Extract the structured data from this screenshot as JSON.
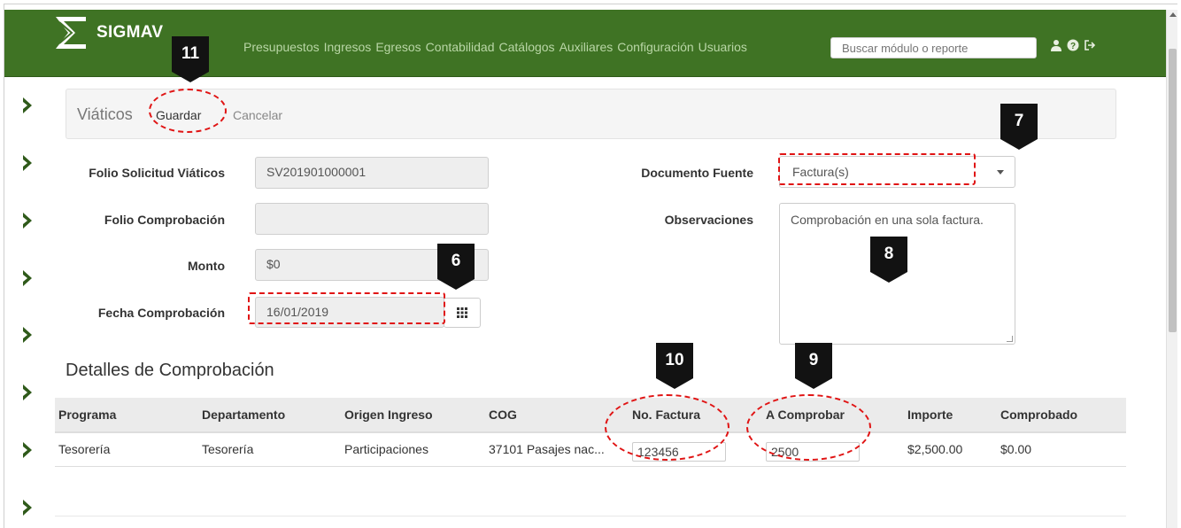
{
  "navbar": {
    "brand": "SIGMAV",
    "menu": [
      "Presupuestos",
      "Ingresos",
      "Egresos",
      "Contabilidad",
      "Catálogos",
      "Auxiliares",
      "Configuración",
      "Usuarios"
    ],
    "search_placeholder": "Buscar módulo o reporte",
    "icons": [
      "user-icon",
      "help-icon",
      "logout-icon"
    ],
    "color": "#3f7324"
  },
  "panel": {
    "title": "Viáticos",
    "save_label": "Guardar",
    "cancel_label": "Cancelar"
  },
  "form": {
    "folio_solicitud": {
      "label": "Folio Solicitud Viáticos",
      "value": "SV201901000001"
    },
    "folio_comprobacion": {
      "label": "Folio Comprobación",
      "value": ""
    },
    "monto": {
      "label": "Monto",
      "value": "$0"
    },
    "fecha": {
      "label": "Fecha Comprobación",
      "value": "16/01/2019"
    },
    "documento_fuente": {
      "label": "Documento Fuente",
      "value": "Factura(s)"
    },
    "observaciones": {
      "label": "Observaciones",
      "value": "Comprobación en una sola factura."
    }
  },
  "details": {
    "title": "Detalles de Comprobación",
    "columns": [
      "Programa",
      "Departamento",
      "Origen Ingreso",
      "COG",
      "No. Factura",
      "A Comprobar",
      "Importe",
      "Comprobado"
    ],
    "rows": [
      {
        "programa": "Tesorería",
        "departamento": "Tesorería",
        "origen": "Participaciones",
        "cog": "37101 Pasajes nac...",
        "factura": "123456",
        "a_comprobar": "2500",
        "importe": "$2,500.00",
        "comprobado": "$0.00"
      }
    ]
  },
  "callouts": [
    "11",
    "7",
    "6",
    "8",
    "10",
    "9"
  ],
  "highlight_color": "#e01414"
}
